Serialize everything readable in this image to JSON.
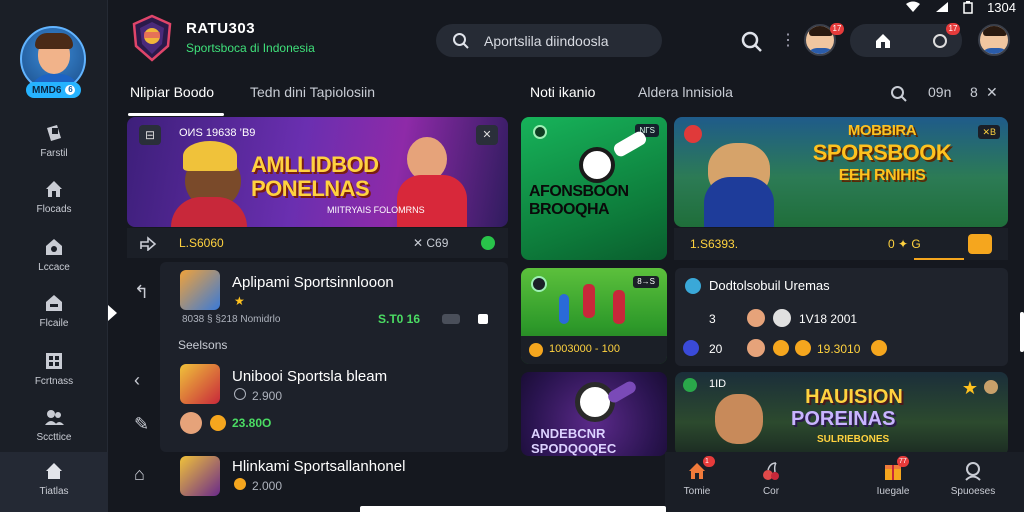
{
  "status": {
    "time": "1304"
  },
  "sidebar": {
    "badge": "MMD6",
    "badge_icon": "6",
    "items": [
      {
        "label": "Farstil",
        "icon": "cards-icon"
      },
      {
        "label": "Flocads",
        "icon": "home-icon"
      },
      {
        "label": "Lccace",
        "icon": "store-icon"
      },
      {
        "label": "Flcaile",
        "icon": "shop-icon"
      },
      {
        "label": "Fcrtnass",
        "icon": "building-icon"
      },
      {
        "label": "Sccttice",
        "icon": "group-icon"
      },
      {
        "label": "Tiatlas",
        "icon": "home-icon"
      }
    ]
  },
  "header": {
    "brand_name": "RATU303",
    "brand_sub": "Sportsboca di Indonesia",
    "search_placeholder": "Aportslila diindoosla",
    "badge1": "17",
    "badge2": "17"
  },
  "tabs": {
    "left": [
      "Nlipiar Boodo",
      "Tedn dini Tapiolosiin"
    ],
    "right": [
      "Noti ikanio",
      "Aldera lnnisiola"
    ],
    "icons_label": "09n",
    "icons_label2": "8"
  },
  "hero": {
    "top_label": "OИS 19638 ’B9",
    "title_line1": "AMLLIDBOD",
    "title_line2": "PONELNAS",
    "sub": "MIITRYAIS FOLOMRNS",
    "amount": "L.S6060",
    "count": "✕  C69"
  },
  "green_card": {
    "title_line1": "AFONSBOON",
    "title_line2": "BROOQHA",
    "tag": "NΓS"
  },
  "sports_card": {
    "title_line1": "MOBBIRA",
    "title_line2": "SPORSBOOK",
    "title_line3": "EEH RNIHIS",
    "tag": "✕B",
    "amount": "1.S6393.",
    "count": "0 ✦ G"
  },
  "list": {
    "items": [
      {
        "name": "Aplipami Sportsinnlooon",
        "meta": "8038 § §218   Nomidrlo",
        "value": "S.T0 16"
      },
      {
        "name": "Unibooi Sportsla bleam",
        "meta": "2.900",
        "value": "23.80O"
      },
      {
        "name": "Hlinkami Sportsallanhonel",
        "meta": "2.000",
        "value": ""
      }
    ],
    "section": "Seelsons"
  },
  "small_green": {
    "tag": "8→S",
    "amount": "1003000 - 100"
  },
  "dark_card": {
    "title_line1": "ANDEBCNR",
    "title_line2": "SPODQOQEC"
  },
  "stats": {
    "title": "Dodtolsobuil Uremas",
    "r1_left": "3",
    "r1_right": "1V18 2001",
    "r2_left": "20",
    "r2_right": "19.3010"
  },
  "fox_card": {
    "top_left": "1ID",
    "title_line1": "HAUISION",
    "title_line2": "POREINAS",
    "sub": "SULRIEBONES"
  },
  "bottom_nav": [
    {
      "label": "Tomie",
      "icon": "home-icon",
      "badge": "1"
    },
    {
      "label": "Cor",
      "icon": "cherry-icon",
      "badge": ""
    },
    {
      "label": "Iuegale",
      "icon": "gift-icon",
      "badge": "77"
    },
    {
      "label": "Spuoeses",
      "icon": "support-icon",
      "badge": ""
    }
  ]
}
